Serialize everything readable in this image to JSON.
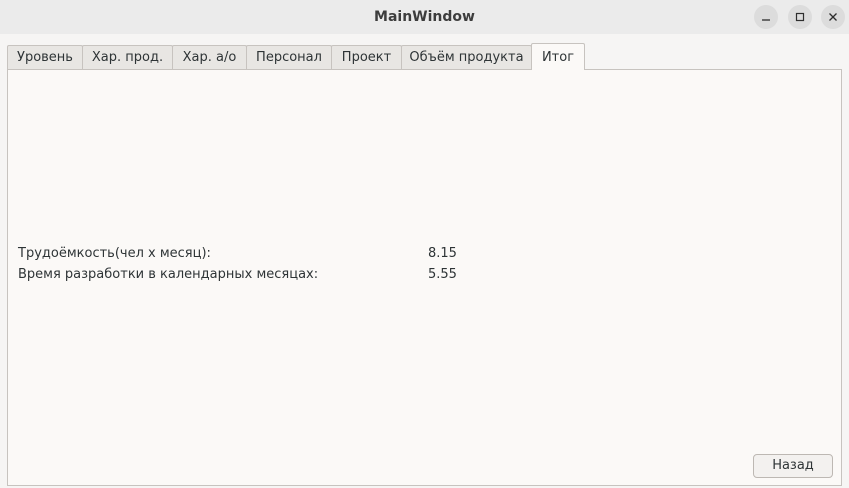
{
  "window": {
    "title": "MainWindow",
    "controls": {
      "minimize_icon": "minimize-icon",
      "maximize_icon": "maximize-icon",
      "close_icon": "close-icon"
    }
  },
  "tabs": [
    {
      "label": "Уровень",
      "active": false
    },
    {
      "label": "Хар. прод.",
      "active": false
    },
    {
      "label": "Хар. а/о",
      "active": false
    },
    {
      "label": "Персонал",
      "active": false
    },
    {
      "label": "Проект",
      "active": false
    },
    {
      "label": "Объём продукта",
      "active": false
    },
    {
      "label": "Итог",
      "active": true
    }
  ],
  "results": {
    "labor": {
      "label": "Трудоёмкость(чел х месяц):",
      "value": "8.15"
    },
    "duration": {
      "label": "Время разработки в календарных месяцах:",
      "value": "5.55"
    }
  },
  "buttons": {
    "back_label": "Назад"
  }
}
